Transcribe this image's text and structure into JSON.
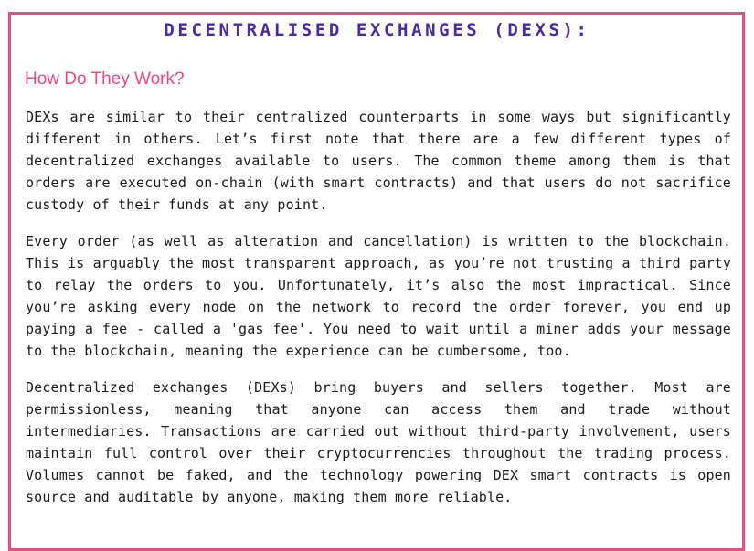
{
  "heading": "DECENTRALISED EXCHANGES (DEXS):",
  "subheading": "How Do They Work?",
  "paragraphs": [
    "DEXs are similar to their centralized counterparts in some ways but significantly different in others. Let’s first note that there are a few different types of decentralized exchanges available to users. The common theme among them is that orders are executed on-chain (with smart contracts) and that users do not sacrifice custody of their funds at any point.",
    "Every order (as well as alteration and cancellation) is written to the blockchain. This is arguably the most transparent approach, as you’re not trusting a third party to relay the orders to you. Unfortunately, it’s also the most impractical. Since you’re asking every node on the network to record the order forever, you end up paying a fee - called a 'gas fee'. You need to wait until a miner adds your message to the blockchain, meaning the experience can be cumbersome, too.",
    "Decentralized exchanges (DEXs) bring buyers and sellers together. Most are permissionless, meaning that anyone can access them and trade without intermediaries. Transactions are carried out without third-party involvement, users maintain full control over their cryptocurrencies throughout the trading process. Volumes cannot be faked, and the technology powering DEX smart contracts is open source and auditable by anyone, making them more reliable."
  ],
  "colors": {
    "border": "#e84d7e",
    "heading": "#4b2a9e",
    "subheading": "#e84d7e",
    "text": "#1a1a1a"
  }
}
